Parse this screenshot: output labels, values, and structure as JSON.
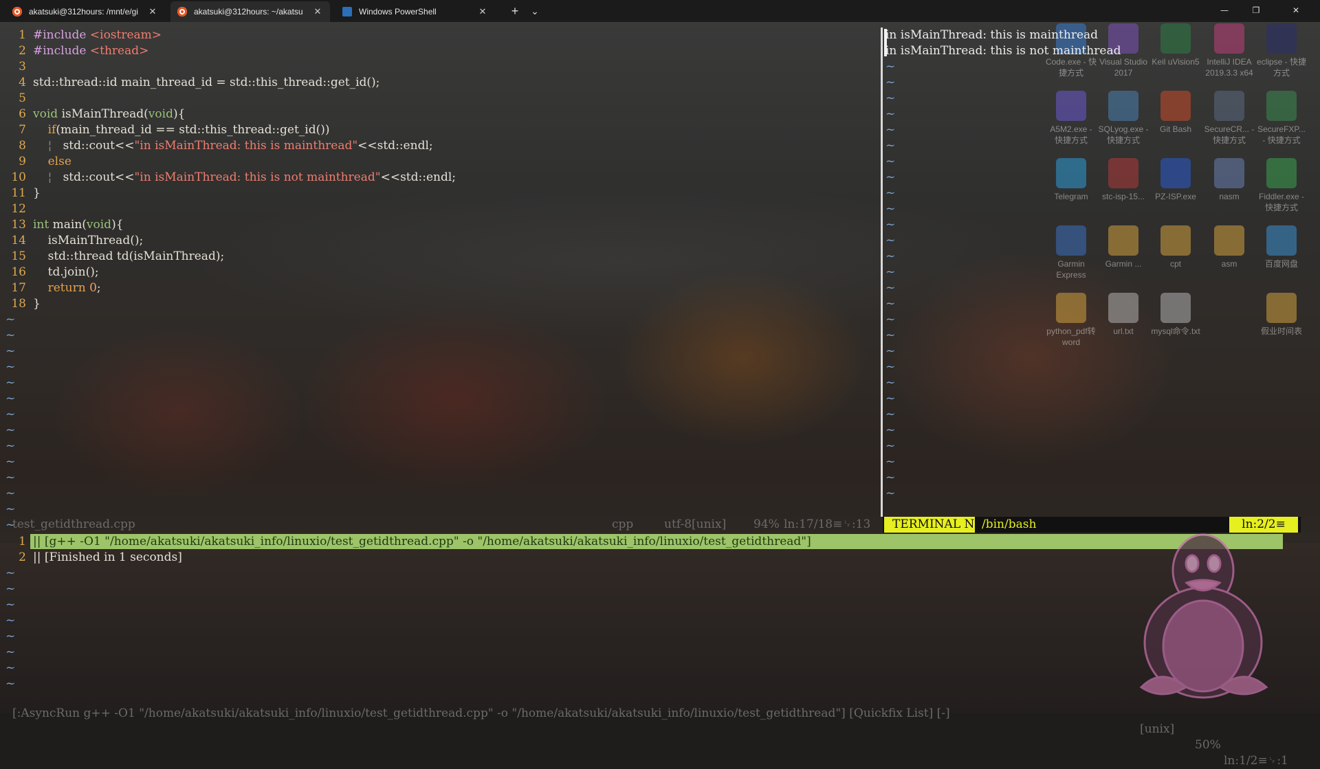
{
  "tabs": [
    {
      "label": "akatsuki@312hours: /mnt/e/gi",
      "icon": "ubuntu-icon",
      "active": false
    },
    {
      "label": "akatsuki@312hours: ~/akatsu",
      "icon": "ubuntu-icon",
      "active": true
    },
    {
      "label": "Windows PowerShell",
      "icon": "powershell-icon",
      "active": false
    }
  ],
  "tabbar": {
    "new_tab": "+",
    "dropdown": "⌄",
    "close": "✕",
    "minimize": "—",
    "maximize": "❐",
    "close_window": "✕"
  },
  "editor": {
    "lines": [
      {
        "n": "1",
        "parts": [
          [
            "pp",
            "#include "
          ],
          [
            "inc",
            "<iostream>"
          ]
        ]
      },
      {
        "n": "2",
        "parts": [
          [
            "pp",
            "#include "
          ],
          [
            "inc",
            "<thread>"
          ]
        ]
      },
      {
        "n": "3",
        "parts": []
      },
      {
        "n": "4",
        "parts": [
          [
            "txt",
            "std::thread::id main_thread_id = std::this_thread::get_id();"
          ]
        ]
      },
      {
        "n": "5",
        "parts": []
      },
      {
        "n": "6",
        "parts": [
          [
            "kw",
            "void"
          ],
          [
            "txt",
            " isMainThread("
          ],
          [
            "kw",
            "void"
          ],
          [
            "txt",
            "){"
          ]
        ]
      },
      {
        "n": "7",
        "parts": [
          [
            "txt",
            "    "
          ],
          [
            "kw2",
            "if"
          ],
          [
            "txt",
            "(main_thread_id == std::this_thread::get_id())"
          ]
        ]
      },
      {
        "n": "8",
        "parts": [
          [
            "guide",
            "    ¦   "
          ],
          [
            "txt",
            "std::cout<<"
          ],
          [
            "str",
            "\"in isMainThread: this is mainthread\""
          ],
          [
            "txt",
            "<<std::endl;"
          ]
        ]
      },
      {
        "n": "9",
        "parts": [
          [
            "txt",
            "    "
          ],
          [
            "kw2",
            "else"
          ]
        ]
      },
      {
        "n": "10",
        "parts": [
          [
            "guide",
            "    ¦   "
          ],
          [
            "txt",
            "std::cout<<"
          ],
          [
            "str",
            "\"in isMainThread: this is not mainthread\""
          ],
          [
            "txt",
            "<<std::endl;"
          ]
        ]
      },
      {
        "n": "11",
        "parts": [
          [
            "txt",
            "}"
          ]
        ]
      },
      {
        "n": "12",
        "parts": []
      },
      {
        "n": "13",
        "parts": [
          [
            "kw",
            "int"
          ],
          [
            "txt",
            " main("
          ],
          [
            "kw",
            "void"
          ],
          [
            "txt",
            "){"
          ]
        ]
      },
      {
        "n": "14",
        "parts": [
          [
            "txt",
            "    isMainThread();"
          ]
        ]
      },
      {
        "n": "15",
        "parts": [
          [
            "txt",
            "    std::thread td(isMainThread);"
          ]
        ]
      },
      {
        "n": "16",
        "parts": [
          [
            "txt",
            "    td.join();"
          ]
        ]
      },
      {
        "n": "17",
        "parts": [
          [
            "txt",
            "    "
          ],
          [
            "kw2",
            "return"
          ],
          [
            "txt",
            " "
          ],
          [
            "num",
            "0"
          ],
          [
            "txt",
            ";"
          ]
        ]
      },
      {
        "n": "18",
        "parts": [
          [
            "txt",
            "}"
          ]
        ]
      }
    ],
    "tilde": "~"
  },
  "terminal": {
    "lines": [
      "in isMainThread: this is mainthread",
      "in isMainThread: this is not mainthread"
    ],
    "tilde": "~"
  },
  "desktop_icons": [
    {
      "label": "Code.exe - 快捷方式",
      "color": "#3b7bd0"
    },
    {
      "label": "Visual Studio 2017",
      "color": "#7b52b8"
    },
    {
      "label": "Keil uVision5",
      "color": "#2d7d46"
    },
    {
      "label": "IntelliJ IDEA 2019.3.3 x64",
      "color": "#c0407a"
    },
    {
      "label": "eclipse - 快捷方式",
      "color": "#2c2f6b"
    },
    {
      "label": "A5M2.exe - 快捷方式",
      "color": "#6a5ad0"
    },
    {
      "label": "SQLyog.exe - 快捷方式",
      "color": "#4a7fb0"
    },
    {
      "label": "Git Bash",
      "color": "#c94b2a"
    },
    {
      "label": "SecureCR... - 快捷方式",
      "color": "#5a6a80"
    },
    {
      "label": "SecureFXP... - 快捷方式",
      "color": "#3a8a50"
    },
    {
      "label": "Telegram",
      "color": "#2d9ad6"
    },
    {
      "label": "stc-isp-15...",
      "color": "#b03a3a"
    },
    {
      "label": "PZ-ISP.exe",
      "color": "#2b5bd0"
    },
    {
      "label": "nasm",
      "color": "#6a7fb0"
    },
    {
      "label": "Fiddler.exe - 快捷方式",
      "color": "#3aa050"
    },
    {
      "label": "Garmin Express",
      "color": "#3a70c0"
    },
    {
      "label": "Garmin ...",
      "color": "#d0a040"
    },
    {
      "label": "cpt",
      "color": "#d0a040"
    },
    {
      "label": "asm",
      "color": "#d0a040"
    },
    {
      "label": "百度网盘",
      "color": "#3a90d0"
    },
    {
      "label": "python_pdf转word",
      "color": "#d0a040"
    },
    {
      "label": "url.txt",
      "color": "#b0b0b0"
    },
    {
      "label": "mysql命令.txt",
      "color": "#b0b0b0"
    },
    {
      "label": "",
      "color": "transparent"
    },
    {
      "label": "假业时间表",
      "color": "#d0a040"
    }
  ],
  "status_left": {
    "filename": "test_getidthread.cpp",
    "filetype": "cpp",
    "encoding": "utf-8[unix]",
    "percent": "94%",
    "position": "ln:17/18≡␊:13"
  },
  "status_term": {
    "mode_name": "TERMINAL",
    "mode": "N",
    "shell": "/bin/bash",
    "position": "ln:2/2≡"
  },
  "quickfix": {
    "lines": [
      {
        "n": "1",
        "text": "|| [g++ -O1 \"/home/akatsuki/akatsuki_info/linuxio/test_getidthread.cpp\" -o \"/home/akatsuki/akatsuki_info/linuxio/test_getidthread\"]"
      },
      {
        "n": "2",
        "text": "|| [Finished in 1 seconds]"
      }
    ],
    "tilde": "~"
  },
  "cmdline": {
    "text": "[:AsyncRun g++ -O1 \"/home/akatsuki/akatsuki_info/linuxio/test_getidthread.cpp\" -o \"/home/akatsuki/akatsuki_info/linuxio/test_getidthread\"] [Quickfix List] [-]",
    "format": "[unix]",
    "percent": "50%",
    "position": "ln:1/2≡␊:1"
  },
  "colors": {
    "quickfix_highlight": "#9ec46a",
    "terminal_mode_bg": "#e6ef1f",
    "line_number": "#e0a84d",
    "tilde": "#7aa7d9"
  }
}
